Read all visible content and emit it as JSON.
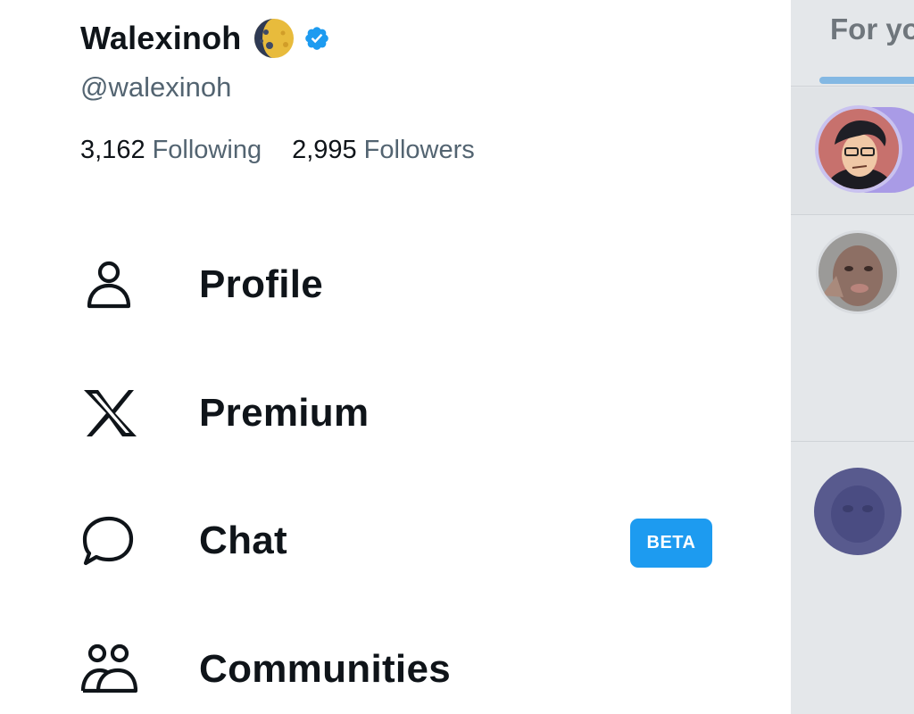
{
  "profile": {
    "display_name": "Walexinoh",
    "handle": "@walexinoh",
    "following_count": "3,162",
    "following_label": "Following",
    "followers_count": "2,995",
    "followers_label": "Followers"
  },
  "menu": {
    "items": [
      {
        "label": "Profile",
        "icon": "person-icon"
      },
      {
        "label": "Premium",
        "icon": "x-logo-icon"
      },
      {
        "label": "Chat",
        "icon": "chat-bubble-icon",
        "badge": "BETA"
      },
      {
        "label": "Communities",
        "icon": "communities-icon"
      }
    ]
  },
  "background": {
    "tab_label": "For yo"
  },
  "colors": {
    "accent": "#1d9bf0",
    "text_primary": "#0f1419",
    "text_secondary": "#536471",
    "backdrop": "#e4e7ea"
  }
}
